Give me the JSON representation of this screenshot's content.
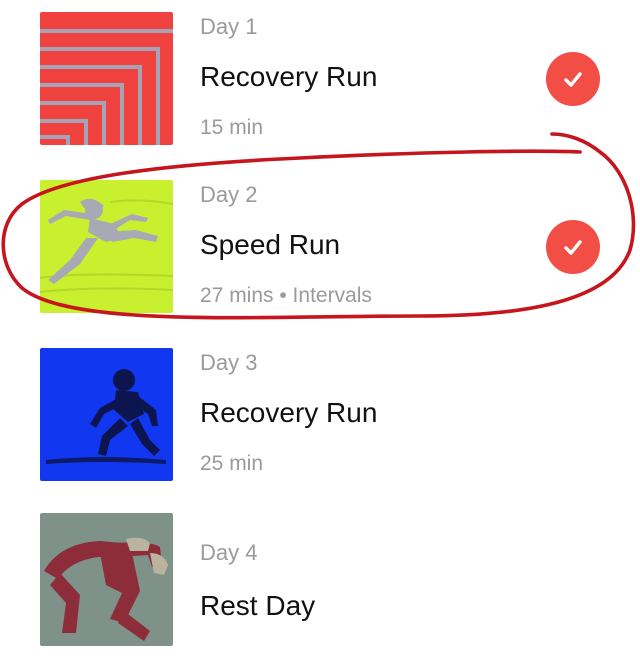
{
  "colors": {
    "accent": "#f24e45",
    "annotation": "#c4161c",
    "day1_thumb": "#f0433f",
    "day2_thumb": "#c9f02e",
    "day3_thumb": "#1237f0",
    "day4_thumb": "#7f9289"
  },
  "workouts": [
    {
      "day": "Day 1",
      "title": "Recovery Run",
      "meta": "15 min",
      "completed": true,
      "thumb_icon": "chevron-stripes-icon"
    },
    {
      "day": "Day 2",
      "title": "Speed Run",
      "meta": "27 mins • Intervals",
      "completed": true,
      "thumb_icon": "runner-icon",
      "highlighted": true
    },
    {
      "day": "Day 3",
      "title": "Recovery Run",
      "meta": "25 min",
      "completed": false,
      "thumb_icon": "runner-icon"
    },
    {
      "day": "Day 4",
      "title": "Rest Day",
      "meta": "",
      "completed": false,
      "thumb_icon": "stretching-figure-icon"
    }
  ]
}
